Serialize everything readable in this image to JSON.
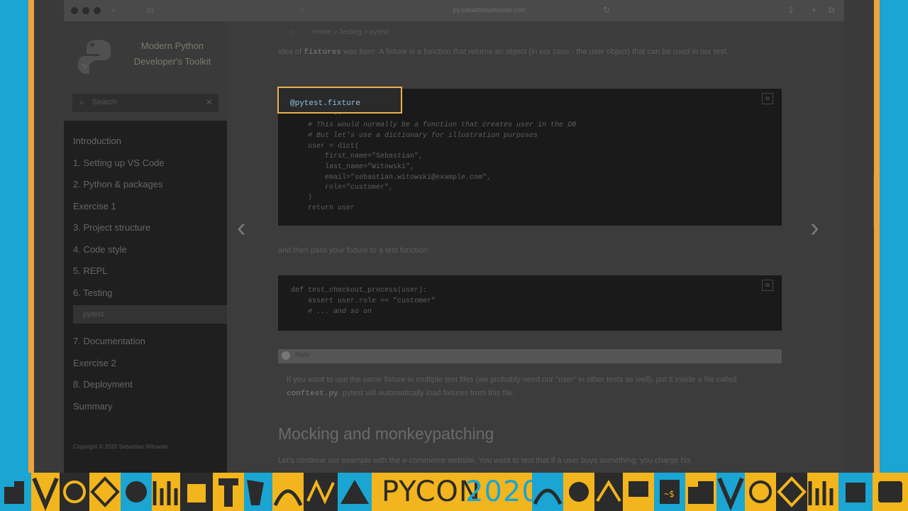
{
  "browser": {
    "url": "py.sebastianwitowski.com"
  },
  "sidebar": {
    "brand_title_line1": "Modern Python",
    "brand_title_line2": "Developer's Toolkit",
    "search_placeholder": "Search",
    "nav": [
      {
        "label": "Introduction"
      },
      {
        "label": "1. Setting up VS Code"
      },
      {
        "label": "2. Python & packages"
      },
      {
        "label": "Exercise 1"
      },
      {
        "label": "3. Project structure"
      },
      {
        "label": "4. Code style"
      },
      {
        "label": "5. REPL"
      },
      {
        "label": "6. Testing"
      }
    ],
    "nav_sub": "pytest",
    "nav_after": [
      {
        "label": "7. Documentation"
      },
      {
        "label": "Exercise 2"
      },
      {
        "label": "8. Deployment"
      },
      {
        "label": "Summary"
      }
    ],
    "copyright": "Copyright © 2020 Sebastian Witowski"
  },
  "content": {
    "breadcrumb": "Home > Testing > pytest",
    "intro_before": "idea of ",
    "intro_code": "fixtures",
    "intro_after": " was born. A fixture is a function that returns an object (in our case - the user object) that can be used in our test.",
    "code1": {
      "highlight": "@pytest.fixture",
      "lines": [
        "def user():",
        "    # This would normally be a function that creates user in the DB",
        "    # But let's use a dictionary for illustration purposes",
        "    user = dict(",
        "        first_name=\"Sebastian\",",
        "        last_name=\"Witowski\",",
        "        email=\"sebastian.witowski@example.com\",",
        "        role=\"customer\",",
        "    )",
        "    return user"
      ]
    },
    "between_text": "and then pass your fixture to a test function:",
    "code2": {
      "lines": [
        "def test_checkout_process(user):",
        "    assert user.role == \"customer\"",
        "    # ... and so on"
      ]
    },
    "note_title": "Note",
    "note_before": "If you want to use the same fixture in multiple test files (we probably need our \"user\" in other tests as well), put it inside a file called ",
    "note_code": "conftest.py",
    "note_after": ". pytest will automatically load fixtures from this file.",
    "heading": "Mocking and monkeypatching",
    "tail_text": "Let's continue our example with the e-commerce website. You want to test that if a user buys something, you charge his"
  },
  "banner": {
    "text_left": "PYCON",
    "text_right": "2020"
  },
  "colors": {
    "accent_highlight": "#e6b24a",
    "banner_yellow": "#f3b51d",
    "banner_blue": "#1aa5d3",
    "banner_dark": "#2b2b2b"
  }
}
